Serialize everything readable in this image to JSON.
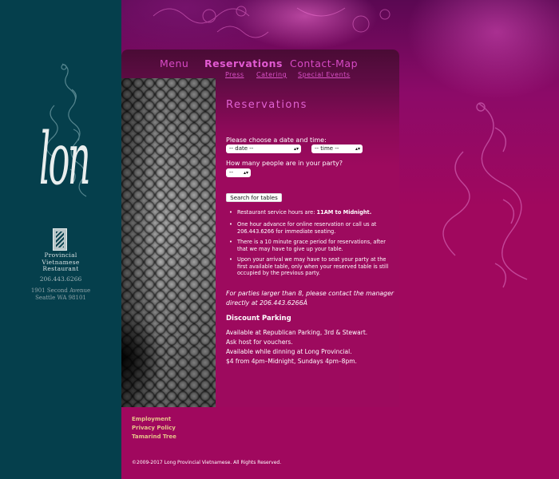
{
  "colors": {
    "rail": "#053f4c",
    "page_bg": "#a0085e",
    "panel": "#9d0a5e",
    "nav_accent": "#d84ac6",
    "footer_link": "#e6c48a"
  },
  "brand": {
    "logo_word": "long",
    "logo_icon": "dragon-icon",
    "name_lines": [
      "Provincial",
      "Vietnamese",
      "Restaurant"
    ],
    "phone": "206.443.6266",
    "address_lines": [
      "1901 Second Avenue",
      "Seattle WA 98101"
    ]
  },
  "nav": {
    "main": [
      {
        "label": "Menu"
      },
      {
        "label": "Reservations"
      },
      {
        "label": "Contact-Map"
      }
    ],
    "sub": [
      {
        "label": "Press"
      },
      {
        "label": "Catering"
      },
      {
        "label": "Special Events"
      }
    ]
  },
  "reservation": {
    "heading": "Reservations",
    "date_prompt": "Please choose a date and time:",
    "date_select": "-- date --",
    "time_select": "-- time --",
    "party_prompt": "How many people are in your party?",
    "party_select": "--",
    "search_button": "Search for tables",
    "notes": [
      {
        "text": "Restaurant service hours are: ",
        "bold": "11AM to Midnight."
      },
      {
        "text": "One hour advance for online reservation or call us at 206.443.6266 for immediate seating."
      },
      {
        "text": "There is a 10 minute grace period for reservations, after that we may have to give up your table."
      },
      {
        "text": "Upon your arrival we may have to seat your party at the first available table, only when your reserved table is still occupied by the previous party."
      }
    ],
    "large_party": "For parties larger than 8, please contact the manager directly at 206.443.6266Â"
  },
  "parking": {
    "title": "Discount Parking",
    "lines": [
      "Available at Republican Parking, 3rd & Stewart.",
      "Ask host for vouchers.",
      "Available while dinning at Long Provincial.",
      "$4 from 4pm–Midnight, Sundays 4pm–8pm."
    ]
  },
  "footer": {
    "links": [
      {
        "label": "Employment"
      },
      {
        "label": "Privacy Policy"
      },
      {
        "label": "Tamarind Tree"
      }
    ],
    "copyright": "©2009-2017 Long Provincial Vietnamese. All Rights Reserved."
  }
}
